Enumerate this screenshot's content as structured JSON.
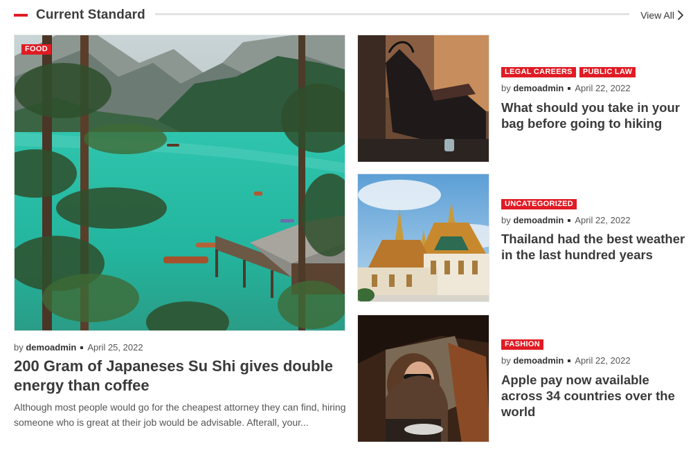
{
  "section": {
    "title": "Current Standard",
    "view_all": "View All"
  },
  "colors": {
    "accent": "#e01b24",
    "text": "#3a3a3a",
    "muted": "#555555"
  },
  "featured": {
    "category": "FOOD",
    "by": "by",
    "author": "demoadmin",
    "date": "April 25, 2022",
    "title": "200 Gram of Japaneses Su Shi gives double energy than coffee",
    "excerpt": "Although most people would go for the cheapest attorney they can find, hiring someone who is great at their job would be advisable. Afterall, your...",
    "image_icon": "lake-with-boats-image"
  },
  "posts": [
    {
      "categories": [
        "LEGAL CAREERS",
        "PUBLIC LAW"
      ],
      "by": "by",
      "author": "demoadmin",
      "date": "April 22, 2022",
      "title": "What should you take in your bag before going to hiking",
      "image_icon": "hiking-bag-image"
    },
    {
      "categories": [
        "UNCATEGORIZED"
      ],
      "by": "by",
      "author": "demoadmin",
      "date": "April 22, 2022",
      "title": "Thailand had the best weather in the last hundred years",
      "image_icon": "thai-temple-image"
    },
    {
      "categories": [
        "FASHION"
      ],
      "by": "by",
      "author": "demoadmin",
      "date": "April 22, 2022",
      "title": "Apple pay now available across 34 countries over the world",
      "image_icon": "woman-in-car-image"
    }
  ]
}
